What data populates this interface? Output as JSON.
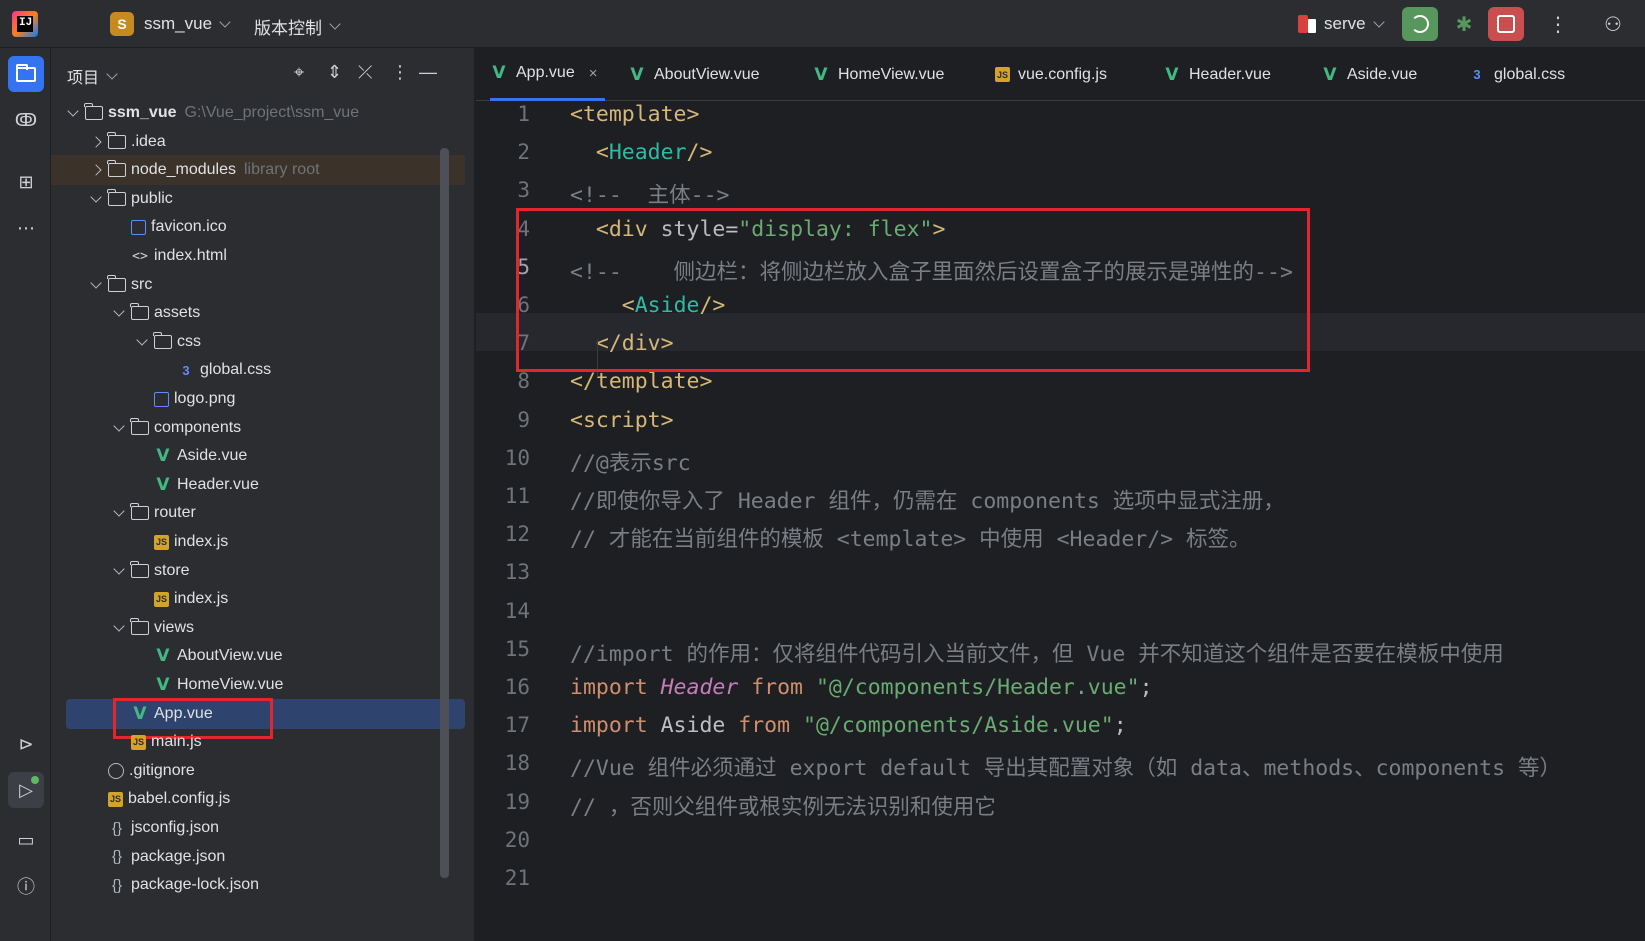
{
  "titlebar": {
    "project_initial": "S",
    "project_name": "ssm_vue",
    "vcs_label": "版本控制",
    "run_config": "serve"
  },
  "project_panel": {
    "title": "项目",
    "tree": [
      {
        "label": "ssm_vue",
        "hint": "G:\\Vue_project\\ssm_vue",
        "depth": 0,
        "arrow": "open",
        "icon": "folder-icon"
      },
      {
        "label": ".idea",
        "depth": 1,
        "arrow": "closed",
        "icon": "folder-icon"
      },
      {
        "label": "node_modules",
        "hint": "library root",
        "depth": 1,
        "arrow": "closed",
        "icon": "folder-icon"
      },
      {
        "label": "public",
        "depth": 1,
        "arrow": "open",
        "icon": "folder-icon"
      },
      {
        "label": "favicon.ico",
        "depth": 2,
        "arrow": "none",
        "icon": "image-icon"
      },
      {
        "label": "index.html",
        "depth": 2,
        "arrow": "none",
        "icon": "html-icon"
      },
      {
        "label": "src",
        "depth": 1,
        "arrow": "open",
        "icon": "folder-icon"
      },
      {
        "label": "assets",
        "depth": 2,
        "arrow": "open",
        "icon": "folder-icon"
      },
      {
        "label": "css",
        "depth": 3,
        "arrow": "open",
        "icon": "folder-icon"
      },
      {
        "label": "global.css",
        "depth": 4,
        "arrow": "none",
        "icon": "css-icon"
      },
      {
        "label": "logo.png",
        "depth": 3,
        "arrow": "none",
        "icon": "image-icon"
      },
      {
        "label": "components",
        "depth": 2,
        "arrow": "open",
        "icon": "folder-icon"
      },
      {
        "label": "Aside.vue",
        "depth": 3,
        "arrow": "none",
        "icon": "vue-icon"
      },
      {
        "label": "Header.vue",
        "depth": 3,
        "arrow": "none",
        "icon": "vue-icon"
      },
      {
        "label": "router",
        "depth": 2,
        "arrow": "open",
        "icon": "folder-icon"
      },
      {
        "label": "index.js",
        "depth": 3,
        "arrow": "none",
        "icon": "js-icon"
      },
      {
        "label": "store",
        "depth": 2,
        "arrow": "open",
        "icon": "folder-icon"
      },
      {
        "label": "index.js",
        "depth": 3,
        "arrow": "none",
        "icon": "js-icon"
      },
      {
        "label": "views",
        "depth": 2,
        "arrow": "open",
        "icon": "folder-icon"
      },
      {
        "label": "AboutView.vue",
        "depth": 3,
        "arrow": "none",
        "icon": "vue-icon"
      },
      {
        "label": "HomeView.vue",
        "depth": 3,
        "arrow": "none",
        "icon": "vue-icon"
      },
      {
        "label": "App.vue",
        "depth": 2,
        "arrow": "none",
        "icon": "vue-icon",
        "selected": true
      },
      {
        "label": "main.js",
        "depth": 2,
        "arrow": "none",
        "icon": "js-icon"
      },
      {
        "label": ".gitignore",
        "depth": 1,
        "arrow": "none",
        "icon": "ignore-icon"
      },
      {
        "label": "babel.config.js",
        "depth": 1,
        "arrow": "none",
        "icon": "js-icon"
      },
      {
        "label": "jsconfig.json",
        "depth": 1,
        "arrow": "none",
        "icon": "json-icon"
      },
      {
        "label": "package.json",
        "depth": 1,
        "arrow": "none",
        "icon": "json-icon"
      },
      {
        "label": "package-lock.json",
        "depth": 1,
        "arrow": "none",
        "icon": "json-icon"
      }
    ]
  },
  "editor": {
    "tabs": [
      {
        "label": "App.vue",
        "icon": "vue-icon",
        "active": true
      },
      {
        "label": "AboutView.vue",
        "icon": "vue-icon"
      },
      {
        "label": "HomeView.vue",
        "icon": "vue-icon"
      },
      {
        "label": "vue.config.js",
        "icon": "js-icon"
      },
      {
        "label": "Header.vue",
        "icon": "vue-icon"
      },
      {
        "label": "Aside.vue",
        "icon": "vue-icon"
      },
      {
        "label": "global.css",
        "icon": "css-icon"
      }
    ],
    "current_line": 5,
    "lines": [
      [
        [
          "tag",
          "<template>"
        ]
      ],
      [
        [
          "tag",
          "  <"
        ],
        [
          "cmp",
          "Header"
        ],
        [
          "tag",
          "/>"
        ]
      ],
      [
        [
          "com",
          "<!--  主体-->"
        ]
      ],
      [
        [
          "tag",
          "  <div "
        ],
        [
          "attr",
          "style"
        ],
        [
          "plain",
          "="
        ],
        [
          "str",
          "\"display: flex\""
        ],
        [
          "tag",
          ">"
        ]
      ],
      [
        [
          "com",
          "<!--    侧边栏：将侧边栏放入盒子里面然后设置盒子的展示是弹性的-->"
        ]
      ],
      [
        [
          "tag",
          "    <"
        ],
        [
          "cmp",
          "Aside"
        ],
        [
          "tag",
          "/>"
        ]
      ],
      [
        [
          "tag",
          "  </div>"
        ]
      ],
      [
        [
          "tag",
          "</template>"
        ]
      ],
      [
        [
          "tag",
          "<script>"
        ]
      ],
      [
        [
          "com",
          "//@表示src"
        ]
      ],
      [
        [
          "com",
          "//即使你导入了 Header 组件，仍需在 components 选项中显式注册，"
        ]
      ],
      [
        [
          "com",
          "// 才能在当前组件的模板 <template> 中使用 <Header/> 标签。"
        ]
      ],
      [],
      [],
      [
        [
          "com",
          "//import 的作用：仅将组件代码引入当前文件，但 Vue 并不知道这个组件是否要在模板中使用"
        ]
      ],
      [
        [
          "kw",
          "import "
        ],
        [
          "ital",
          "Header"
        ],
        [
          "kw",
          " from "
        ],
        [
          "str",
          "\"@/components/Header.vue\""
        ],
        [
          "plain",
          ";"
        ]
      ],
      [
        [
          "kw",
          "import "
        ],
        [
          "plain",
          "Aside"
        ],
        [
          "kw",
          " from "
        ],
        [
          "str",
          "\"@/components/Aside.vue\""
        ],
        [
          "plain",
          ";"
        ]
      ],
      [
        [
          "com",
          "//Vue 组件必须通过 export default 导出其配置对象（如 data、methods、components 等）"
        ]
      ],
      [
        [
          "com",
          "// ，否则父组件或根实例无法识别和使用它"
        ]
      ],
      [],
      []
    ]
  },
  "colors": {
    "accent": "#3574f0",
    "highlight_box": "#e2262b",
    "vue": "#42b883"
  }
}
